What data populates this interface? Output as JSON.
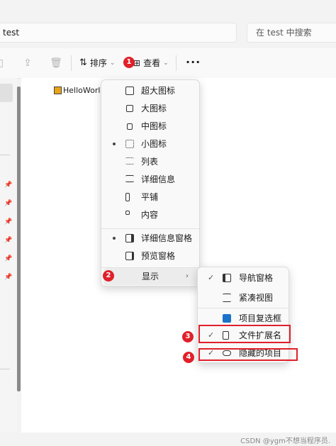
{
  "address": {
    "path": "test"
  },
  "search": {
    "placeholder": "在 test 中搜索"
  },
  "toolbar": {
    "sort_label": "排序",
    "view_label": "查看",
    "more_label": "···"
  },
  "content": {
    "files": [
      {
        "name": "HelloWorld",
        "icon": "sublime-file-icon"
      }
    ]
  },
  "view_menu": {
    "items": [
      {
        "label": "超大图标",
        "icon": "extra-large-icons-icon",
        "selected": false
      },
      {
        "label": "大图标",
        "icon": "large-icons-icon",
        "selected": false
      },
      {
        "label": "中图标",
        "icon": "medium-icons-icon",
        "selected": false
      },
      {
        "label": "小图标",
        "icon": "small-icons-icon",
        "selected": true
      },
      {
        "label": "列表",
        "icon": "list-icon",
        "selected": false
      },
      {
        "label": "详细信息",
        "icon": "details-icon",
        "selected": false
      },
      {
        "label": "平铺",
        "icon": "tiles-icon",
        "selected": false
      },
      {
        "label": "内容",
        "icon": "content-icon",
        "selected": false
      }
    ],
    "pane_items": [
      {
        "label": "详细信息窗格",
        "icon": "details-pane-icon",
        "selected": true
      },
      {
        "label": "预览窗格",
        "icon": "preview-pane-icon",
        "selected": false
      }
    ],
    "show_label": "显示"
  },
  "show_submenu": {
    "items": [
      {
        "label": "导航窗格",
        "icon": "navigation-pane-icon",
        "checked": true
      },
      {
        "label": "紧凑视图",
        "icon": "compact-view-icon",
        "checked": false
      },
      {
        "label": "项目复选框",
        "icon": "item-checkbox-icon",
        "checked": false
      },
      {
        "label": "文件扩展名",
        "icon": "file-extension-icon",
        "checked": true
      },
      {
        "label": "隐藏的项目",
        "icon": "hidden-items-icon",
        "checked": true
      }
    ]
  },
  "annotations": {
    "step1": "1",
    "step2": "2",
    "step3": "3",
    "step4": "4"
  },
  "colors": {
    "badge": "#e0202a",
    "menu_bg": "#f9f9f9"
  },
  "watermark": "CSDN @ygm不想当程序员."
}
